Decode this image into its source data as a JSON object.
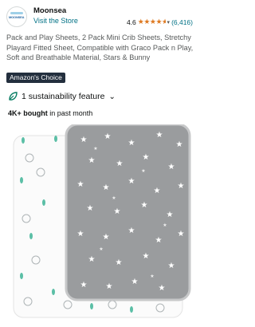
{
  "store": {
    "brand": "Moonsea",
    "visit_label": "Visit the Store",
    "logo_text": "MOONSEA",
    "rating_value": "4.6",
    "rating_count": "(6,416)",
    "stars_shown": 4.5
  },
  "product": {
    "title": "Pack and Play Sheets, 2 Pack Mini Crib Sheets, Stretchy Playard Fitted Sheet, Compatible with Graco Pack n Play, Soft and Breathable Material, Stars & Bunny",
    "badge": "Amazon's Choice",
    "sustainability": "1 sustainability feature",
    "bought_bold": "4K+ bought",
    "bought_rest": " in past month"
  },
  "colors": {
    "link": "#007185",
    "star": "#de7921",
    "badge_bg": "#232f3e",
    "leaf": "#067d62"
  },
  "icons": {
    "store_logo": "store-logo-icon",
    "rating_chevron": "chevron-down-icon",
    "sustainability": "leaf-icon",
    "sustainability_chevron": "chevron-down-icon"
  }
}
